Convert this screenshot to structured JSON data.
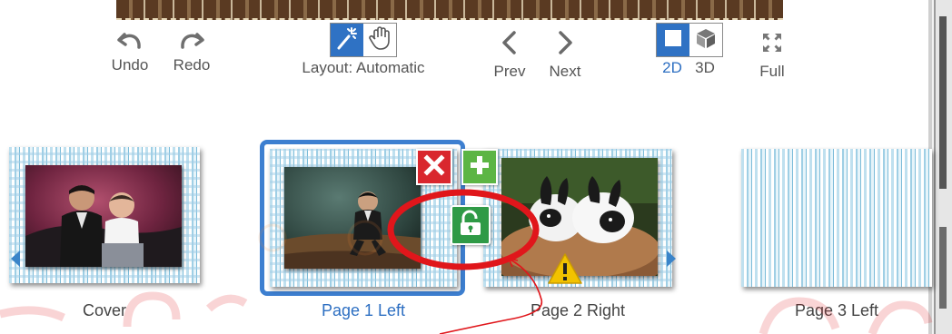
{
  "toolbar": {
    "undo_label": "Undo",
    "redo_label": "Redo",
    "layout_label": "Layout: Automatic",
    "prev_label": "Prev",
    "next_label": "Next",
    "view_2d_label": "2D",
    "view_3d_label": "3D",
    "full_label": "Full"
  },
  "pages": [
    {
      "caption": "Cover"
    },
    {
      "caption": "Page 1 Left"
    },
    {
      "caption": "Page 2 Right"
    },
    {
      "caption": "Page 3 Left"
    }
  ],
  "icons": {
    "undo": "undo-icon",
    "redo": "redo-icon",
    "auto_layout": "magic-wand-icon",
    "manual_layout": "hand-icon",
    "prev": "chevron-left-icon",
    "next": "chevron-right-icon",
    "view_2d": "square-icon",
    "view_3d": "cube-icon",
    "full": "fullscreen-icon",
    "remove": "close-icon",
    "add": "plus-icon",
    "lock": "unlock-icon",
    "warning": "warning-icon"
  },
  "colors": {
    "accent": "#2f72c4",
    "selected_text": "#2d6fc2",
    "remove_button": "#d9272e",
    "add_button": "#5cb544",
    "lock_button": "#2f9a46",
    "warning": "#f2c200",
    "annotation": "#e0161b"
  }
}
